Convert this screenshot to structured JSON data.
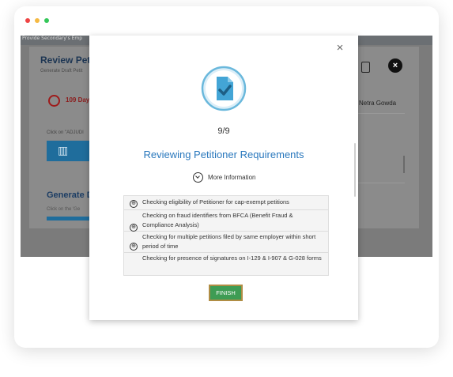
{
  "window": {
    "dot_colors": [
      "#ef4444",
      "#f5b942",
      "#34c759"
    ]
  },
  "background": {
    "top_strip_text": "Provide Secondary's Emp",
    "title": "Review Peti",
    "subtitle": "Generate Draft Petit",
    "days": "109 Day",
    "click_text": "Click on \"ADJUDI",
    "generate_title": "Generate D",
    "generate_sub": "Click on the 'Ge",
    "user_name": "Netra Gowda",
    "close_label": "×"
  },
  "modal": {
    "close_label": "×",
    "count": "9/9",
    "title": "Reviewing Petitioner Requirements",
    "more_info": "More Information",
    "items": [
      {
        "icon": "⊕",
        "text": "Checking eligibility of Petitioner for cap-exempt petitions"
      },
      {
        "icon": "⊕",
        "text": "Checking on fraud identifiers from BFCA (Benefit Fraud & Compliance Analysis)"
      },
      {
        "icon": "⊕",
        "text": "Checking for multiple petitions filed by same employer within short period of time"
      },
      {
        "icon": "",
        "text": "Checking for presence of signatures on I-129 & I-907 & G-028 forms"
      }
    ],
    "finish_label": "FINISH"
  },
  "colors": {
    "accent_blue": "#2a78bd",
    "finish_green": "#3e9c54"
  }
}
